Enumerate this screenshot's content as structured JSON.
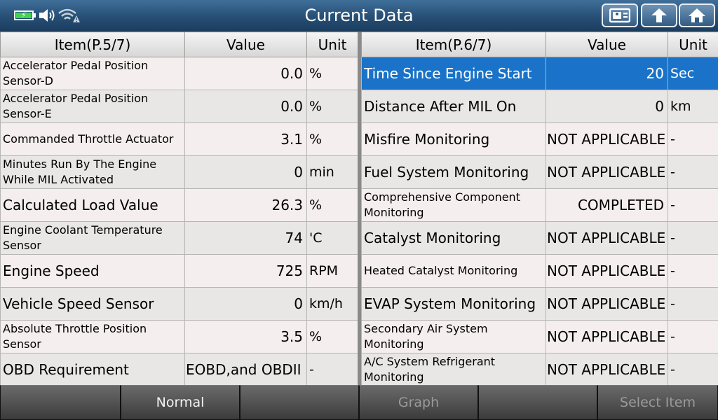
{
  "header": {
    "title": "Current Data"
  },
  "left_table": {
    "headers": {
      "item": "Item(P.5/7)",
      "value": "Value",
      "unit": "Unit"
    },
    "rows": [
      {
        "item": "Accelerator Pedal Position Sensor-D",
        "value": "0.0",
        "unit": "%"
      },
      {
        "item": "Accelerator Pedal Position Sensor-E",
        "value": "0.0",
        "unit": "%"
      },
      {
        "item": "Commanded Throttle Actuator",
        "value": "3.1",
        "unit": "%"
      },
      {
        "item": "Minutes Run By The Engine While MIL Activated",
        "value": "0",
        "unit": "min"
      },
      {
        "item": "Calculated Load Value",
        "value": "26.3",
        "unit": "%"
      },
      {
        "item": "Engine Coolant Temperature Sensor",
        "value": "74",
        "unit": "'C"
      },
      {
        "item": "Engine Speed",
        "value": "725",
        "unit": "RPM"
      },
      {
        "item": "Vehicle Speed Sensor",
        "value": "0",
        "unit": "km/h"
      },
      {
        "item": "Absolute Throttle Position Sensor",
        "value": "3.5",
        "unit": "%"
      },
      {
        "item": "OBD Requirement",
        "value": "EOBD,and OBDII",
        "unit": "-"
      }
    ]
  },
  "right_table": {
    "headers": {
      "item": "Item(P.6/7)",
      "value": "Value",
      "unit": "Unit"
    },
    "rows": [
      {
        "item": "Time Since Engine Start",
        "value": "20",
        "unit": "Sec",
        "selected": true
      },
      {
        "item": "Distance After MIL On",
        "value": "0",
        "unit": "km"
      },
      {
        "item": "Misfire Monitoring",
        "value": "NOT APPLICABLE",
        "unit": "-"
      },
      {
        "item": "Fuel System Monitoring",
        "value": "NOT APPLICABLE",
        "unit": "-"
      },
      {
        "item": "Comprehensive Component Monitoring",
        "value": "COMPLETED",
        "unit": "-"
      },
      {
        "item": "Catalyst Monitoring",
        "value": "NOT APPLICABLE",
        "unit": "-"
      },
      {
        "item": "Heated Catalyst Monitoring",
        "value": "NOT APPLICABLE",
        "unit": "-"
      },
      {
        "item": "EVAP System Monitoring",
        "value": "NOT APPLICABLE",
        "unit": "-"
      },
      {
        "item": "Secondary Air System Monitoring",
        "value": "NOT APPLICABLE",
        "unit": "-"
      },
      {
        "item": "A/C System Refrigerant Monitoring",
        "value": "NOT APPLICABLE",
        "unit": "-"
      }
    ]
  },
  "toolbar": {
    "buttons": [
      {
        "label": ""
      },
      {
        "label": "Normal"
      },
      {
        "label": ""
      },
      {
        "label": "Graph",
        "disabled": true
      },
      {
        "label": ""
      },
      {
        "label": "Select Item",
        "disabled": true
      }
    ]
  },
  "colors": {
    "selected_row": "#1a73c8",
    "title_bar": "#274f75",
    "battery_fill": "#3fd64a"
  },
  "icons": [
    "battery-charging-icon",
    "speaker-icon",
    "wifi-warning-icon",
    "screenshot-icon",
    "back-arrow-icon",
    "home-icon"
  ]
}
